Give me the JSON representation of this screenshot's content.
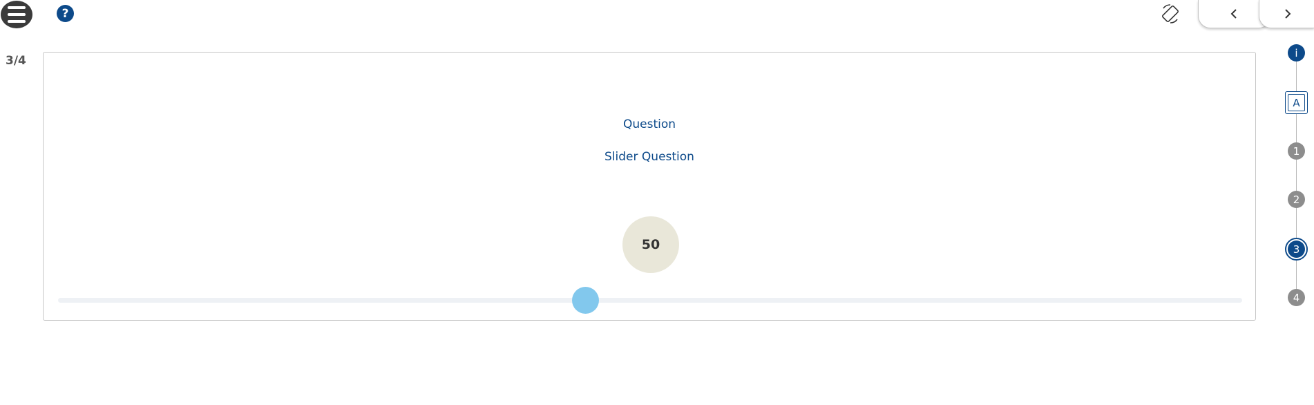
{
  "header": {
    "menu_icon": "hamburger-icon",
    "help_label": "?",
    "rotate_icon": "screen-rotation-icon",
    "prev_icon": "chevron-left-icon",
    "next_icon": "chevron-right-icon"
  },
  "progress": "3/4",
  "question": {
    "title": "Question",
    "subtitle": "Slider Question"
  },
  "slider": {
    "value": "50",
    "thumb_fraction": 0.445
  },
  "stepper": {
    "info_label": "i",
    "a_label": "A",
    "steps": [
      "1",
      "2",
      "3",
      "4"
    ],
    "active_step": "3"
  },
  "colors": {
    "primary": "#0d4a8a",
    "slider_thumb": "#82c8ed",
    "value_bubble": "#e9e7d9",
    "step_inactive": "#8d8d8d"
  }
}
